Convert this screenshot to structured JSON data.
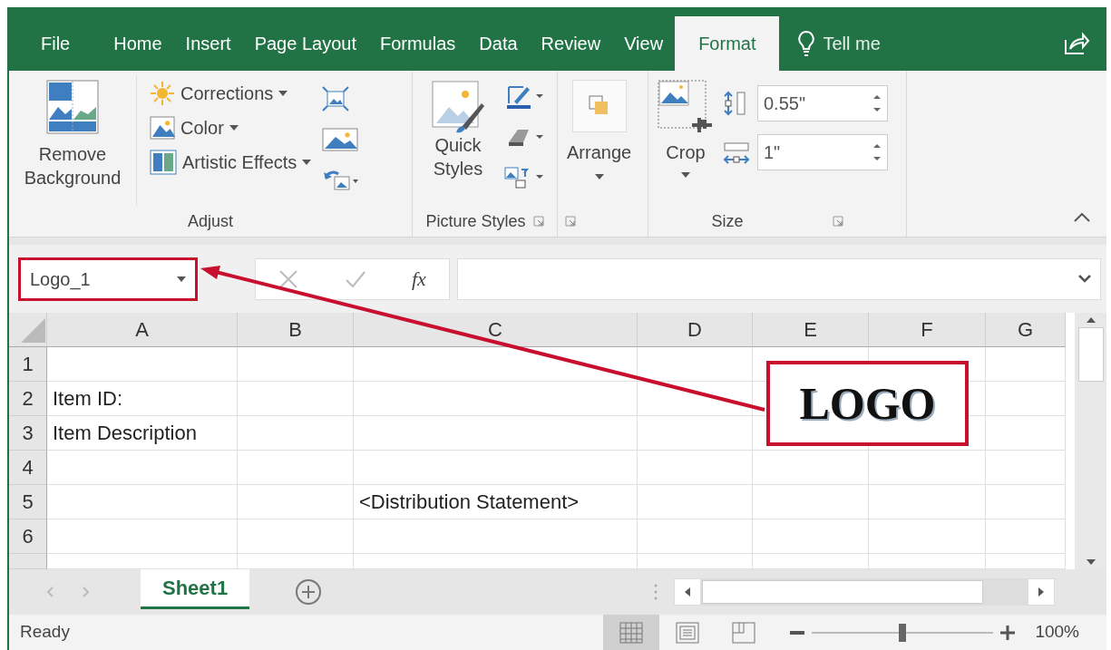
{
  "tabs": [
    {
      "label": "File",
      "selected": false
    },
    {
      "label": "Home",
      "selected": false
    },
    {
      "label": "Insert",
      "selected": false
    },
    {
      "label": "Page Layout",
      "selected": false
    },
    {
      "label": "Formulas",
      "selected": false
    },
    {
      "label": "Data",
      "selected": false
    },
    {
      "label": "Review",
      "selected": false
    },
    {
      "label": "View",
      "selected": false
    },
    {
      "label": "Format",
      "selected": true
    }
  ],
  "tell_me": "Tell me",
  "ribbon": {
    "groups": [
      {
        "kind": "adjust",
        "label": "Adjust",
        "big_button": "Remove Background",
        "items": [
          "Corrections",
          "Color",
          "Artistic Effects"
        ]
      },
      {
        "kind": "styles",
        "label": "Picture Styles",
        "big_button": "Quick Styles"
      },
      {
        "kind": "arrange",
        "big_button": "Arrange"
      },
      {
        "kind": "size",
        "label": "Size",
        "big_button": "Crop",
        "height": "0.55\"",
        "width": "1\""
      }
    ]
  },
  "formula_bar": {
    "name_box": "Logo_1",
    "fx": "fx"
  },
  "sheet": {
    "columns": [
      "A",
      "B",
      "C",
      "D",
      "E",
      "F",
      "G"
    ],
    "rows": [
      {
        "number": "1"
      },
      {
        "number": "2",
        "a": "Item ID:"
      },
      {
        "number": "3",
        "a": "Item Description"
      },
      {
        "number": "4"
      },
      {
        "number": "5",
        "c": "<Distribution Statement>"
      },
      {
        "number": "6"
      }
    ],
    "logo": "LOGO"
  },
  "sheet_tabs": [
    {
      "label": "Sheet1",
      "selected": true
    }
  ],
  "status_bar": {
    "text": "Ready",
    "views": [
      {
        "kind": "normal",
        "selected": true
      },
      {
        "kind": "page_layout",
        "selected": false
      },
      {
        "kind": "page_break",
        "selected": false
      }
    ],
    "zoom": {
      "level": 0.5,
      "reading": "100%"
    }
  }
}
